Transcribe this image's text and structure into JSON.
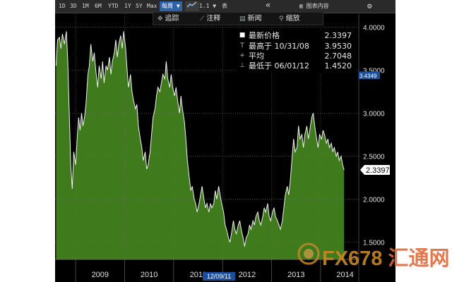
{
  "toolbar": {
    "ranges": [
      "1D",
      "3D",
      "1M",
      "6M",
      "YTD",
      "1Y",
      "5Y",
      "Max"
    ],
    "period": "每周 ▼",
    "tools": "1.1 ▼",
    "extra": "表",
    "collapse": "«",
    "table_label": "图表内容",
    "settings": "⚙"
  },
  "subbar": {
    "track": "追踪",
    "annotate": "注释",
    "news": "新闻",
    "zoom": "缩放"
  },
  "legend": {
    "rows": [
      {
        "icon": "■",
        "label": "最新价格",
        "value": "2.3397"
      },
      {
        "icon": "T",
        "label": "最高于 10/31/08",
        "value": "3.9530"
      },
      {
        "icon": "+",
        "label": "平均",
        "value": "2.7048"
      },
      {
        "icon": "⊥",
        "label": "最低于 06/01/12",
        "value": "1.4520"
      }
    ]
  },
  "markers": {
    "avg_label": "3.4349",
    "last_label": "2.3397",
    "date_cursor": "12/09/11"
  },
  "watermark": {
    "text": "FX678",
    "cn": "汇通网"
  },
  "colors": {
    "fill": "#3f7a1c",
    "line": "#f2f2f2",
    "background": "#000000"
  },
  "chart_data": {
    "type": "area",
    "x_label_years": [
      "2009",
      "2010",
      "2011",
      "2012",
      "2013",
      "2014"
    ],
    "ylim": [
      1.3,
      4.15
    ],
    "yticks": [
      "1.5000",
      "2.0000",
      "2.5000",
      "3.0000",
      "3.5000",
      "4.0000"
    ],
    "grid": true,
    "x_start": 2008.58,
    "x_end": 2014.78,
    "series": [
      {
        "values": [
          [
            2008.6,
            3.55
          ],
          [
            2008.63,
            3.85
          ],
          [
            2008.67,
            3.88
          ],
          [
            2008.7,
            3.75
          ],
          [
            2008.73,
            3.92
          ],
          [
            2008.77,
            3.8
          ],
          [
            2008.81,
            3.95
          ],
          [
            2008.84,
            3.6
          ],
          [
            2008.87,
            3.0
          ],
          [
            2008.9,
            2.4
          ],
          [
            2008.93,
            2.12
          ],
          [
            2008.96,
            2.55
          ],
          [
            2009.0,
            2.4
          ],
          [
            2009.03,
            2.7
          ],
          [
            2009.06,
            2.95
          ],
          [
            2009.09,
            2.8
          ],
          [
            2009.12,
            3.0
          ],
          [
            2009.15,
            2.85
          ],
          [
            2009.18,
            2.95
          ],
          [
            2009.21,
            3.1
          ],
          [
            2009.25,
            3.45
          ],
          [
            2009.28,
            3.55
          ],
          [
            2009.31,
            3.8
          ],
          [
            2009.35,
            3.6
          ],
          [
            2009.38,
            3.7
          ],
          [
            2009.41,
            3.5
          ],
          [
            2009.45,
            3.3
          ],
          [
            2009.48,
            3.55
          ],
          [
            2009.52,
            3.4
          ],
          [
            2009.55,
            3.6
          ],
          [
            2009.58,
            3.35
          ],
          [
            2009.62,
            3.55
          ],
          [
            2009.65,
            3.5
          ],
          [
            2009.69,
            3.65
          ],
          [
            2009.72,
            3.45
          ],
          [
            2009.75,
            3.6
          ],
          [
            2009.79,
            3.7
          ],
          [
            2009.82,
            3.85
          ],
          [
            2009.85,
            3.65
          ],
          [
            2009.88,
            3.8
          ],
          [
            2009.92,
            3.9
          ],
          [
            2009.95,
            3.75
          ],
          [
            2009.98,
            3.95
          ],
          [
            2010.02,
            3.75
          ],
          [
            2010.05,
            3.5
          ],
          [
            2010.08,
            3.3
          ],
          [
            2010.12,
            3.45
          ],
          [
            2010.15,
            3.25
          ],
          [
            2010.18,
            3.15
          ],
          [
            2010.22,
            3.05
          ],
          [
            2010.25,
            3.1
          ],
          [
            2010.28,
            2.85
          ],
          [
            2010.32,
            2.7
          ],
          [
            2010.35,
            2.6
          ],
          [
            2010.38,
            2.45
          ],
          [
            2010.42,
            2.55
          ],
          [
            2010.45,
            2.35
          ],
          [
            2010.48,
            2.4
          ],
          [
            2010.52,
            2.55
          ],
          [
            2010.55,
            2.75
          ],
          [
            2010.58,
            2.95
          ],
          [
            2010.62,
            3.05
          ],
          [
            2010.65,
            3.2
          ],
          [
            2010.68,
            3.3
          ],
          [
            2010.72,
            3.25
          ],
          [
            2010.75,
            3.35
          ],
          [
            2010.78,
            3.45
          ],
          [
            2010.82,
            3.4
          ],
          [
            2010.85,
            3.6
          ],
          [
            2010.88,
            3.4
          ],
          [
            2010.92,
            3.3
          ],
          [
            2010.95,
            3.45
          ],
          [
            2010.98,
            3.3
          ],
          [
            2011.02,
            3.2
          ],
          [
            2011.05,
            3.3
          ],
          [
            2011.08,
            3.15
          ],
          [
            2011.12,
            3.0
          ],
          [
            2011.15,
            3.2
          ],
          [
            2011.18,
            3.05
          ],
          [
            2011.22,
            2.9
          ],
          [
            2011.25,
            2.7
          ],
          [
            2011.28,
            2.45
          ],
          [
            2011.32,
            2.25
          ],
          [
            2011.35,
            2.1
          ],
          [
            2011.38,
            2.15
          ],
          [
            2011.42,
            2.0
          ],
          [
            2011.45,
            1.95
          ],
          [
            2011.48,
            1.85
          ],
          [
            2011.52,
            1.95
          ],
          [
            2011.55,
            2.05
          ],
          [
            2011.58,
            2.15
          ],
          [
            2011.62,
            2.0
          ],
          [
            2011.65,
            1.9
          ],
          [
            2011.68,
            1.95
          ],
          [
            2011.72,
            1.85
          ],
          [
            2011.75,
            1.95
          ],
          [
            2011.78,
            1.9
          ],
          [
            2011.82,
            1.95
          ],
          [
            2011.85,
            2.1
          ],
          [
            2011.88,
            2.0
          ],
          [
            2011.92,
            2.15
          ],
          [
            2011.95,
            2.05
          ],
          [
            2011.98,
            1.95
          ],
          [
            2012.02,
            1.85
          ],
          [
            2012.05,
            1.7
          ],
          [
            2012.08,
            1.65
          ],
          [
            2012.12,
            1.55
          ],
          [
            2012.15,
            1.5
          ],
          [
            2012.18,
            1.6
          ],
          [
            2012.22,
            1.75
          ],
          [
            2012.25,
            1.65
          ],
          [
            2012.28,
            1.6
          ],
          [
            2012.32,
            1.7
          ],
          [
            2012.35,
            1.75
          ],
          [
            2012.38,
            1.65
          ],
          [
            2012.42,
            1.55
          ],
          [
            2012.45,
            1.45
          ],
          [
            2012.48,
            1.55
          ],
          [
            2012.52,
            1.6
          ],
          [
            2012.55,
            1.7
          ],
          [
            2012.58,
            1.65
          ],
          [
            2012.62,
            1.75
          ],
          [
            2012.65,
            1.7
          ],
          [
            2012.68,
            1.8
          ],
          [
            2012.72,
            1.85
          ],
          [
            2012.75,
            1.75
          ],
          [
            2012.78,
            1.7
          ],
          [
            2012.82,
            1.8
          ],
          [
            2012.85,
            1.9
          ],
          [
            2012.88,
            1.85
          ],
          [
            2012.92,
            1.95
          ],
          [
            2012.95,
            1.8
          ],
          [
            2012.98,
            1.75
          ],
          [
            2013.02,
            1.85
          ],
          [
            2013.05,
            1.9
          ],
          [
            2013.08,
            1.8
          ],
          [
            2013.12,
            1.75
          ],
          [
            2013.15,
            1.7
          ],
          [
            2013.18,
            1.65
          ],
          [
            2013.22,
            1.75
          ],
          [
            2013.25,
            1.9
          ],
          [
            2013.28,
            2.05
          ],
          [
            2013.32,
            2.15
          ],
          [
            2013.35,
            2.05
          ],
          [
            2013.38,
            2.2
          ],
          [
            2013.42,
            2.5
          ],
          [
            2013.45,
            2.7
          ],
          [
            2013.48,
            2.55
          ],
          [
            2013.52,
            2.6
          ],
          [
            2013.55,
            2.85
          ],
          [
            2013.58,
            2.7
          ],
          [
            2013.62,
            2.75
          ],
          [
            2013.65,
            2.6
          ],
          [
            2013.68,
            2.75
          ],
          [
            2013.72,
            2.85
          ],
          [
            2013.75,
            2.7
          ],
          [
            2013.78,
            2.8
          ],
          [
            2013.82,
            2.95
          ],
          [
            2013.85,
            3.0
          ],
          [
            2013.88,
            2.85
          ],
          [
            2013.92,
            2.7
          ],
          [
            2013.95,
            2.6
          ],
          [
            2013.98,
            2.75
          ],
          [
            2014.02,
            2.7
          ],
          [
            2014.05,
            2.8
          ],
          [
            2014.08,
            2.75
          ],
          [
            2014.12,
            2.65
          ],
          [
            2014.15,
            2.7
          ],
          [
            2014.18,
            2.6
          ],
          [
            2014.22,
            2.65
          ],
          [
            2014.25,
            2.55
          ],
          [
            2014.28,
            2.6
          ],
          [
            2014.32,
            2.5
          ],
          [
            2014.35,
            2.55
          ],
          [
            2014.38,
            2.45
          ],
          [
            2014.42,
            2.5
          ],
          [
            2014.45,
            2.4
          ],
          [
            2014.48,
            2.34
          ]
        ]
      }
    ]
  }
}
